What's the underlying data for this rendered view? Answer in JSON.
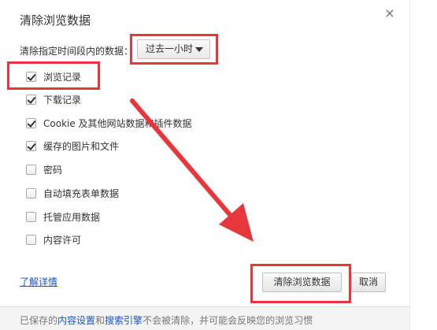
{
  "dialog": {
    "title": "清除浏览数据",
    "close_glyph": "×"
  },
  "range": {
    "label": "清除指定时间段内的数据：",
    "selected": "过去一小时"
  },
  "options": [
    {
      "label": "浏览记录",
      "checked": true
    },
    {
      "label": "下载记录",
      "checked": true
    },
    {
      "label": "Cookie 及其他网站数据和插件数据",
      "checked": true
    },
    {
      "label": "缓存的图片和文件",
      "checked": true
    },
    {
      "label": "密码",
      "checked": false
    },
    {
      "label": "自动填充表单数据",
      "checked": false
    },
    {
      "label": "托管应用数据",
      "checked": false
    },
    {
      "label": "内容许可",
      "checked": false
    }
  ],
  "actions": {
    "learn_more": "了解详情",
    "clear_button": "清除浏览数据",
    "cancel_button": "取消"
  },
  "footer": {
    "prefix": "已保存的",
    "link1": "内容设置",
    "middle": "和",
    "link2": "搜索引擎",
    "suffix": "不会被清除，并可能会反映您的浏览习惯"
  },
  "annotation": {
    "highlight_color": "#e8363d"
  }
}
